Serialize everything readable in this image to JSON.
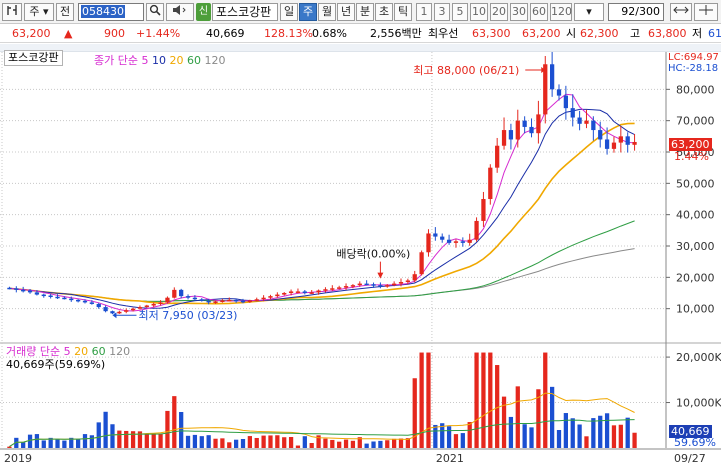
{
  "toolbar": {
    "market": "주",
    "prev_label": "전",
    "stock_code": "058430",
    "stock_name": "포스코강판",
    "badge": "신",
    "periods": [
      "일",
      "주",
      "월",
      "년",
      "분",
      "초",
      "틱"
    ],
    "active_period": "주",
    "minute_options": [
      "1",
      "3",
      "5",
      "10",
      "20",
      "30",
      "60",
      "120"
    ],
    "count": "92/300"
  },
  "quote": {
    "price": "63,200",
    "change": "900",
    "change_pct": "+1.44%",
    "volume": "40,669",
    "volume_ratio": "128.13%",
    "turnover": "0.68%",
    "amount": "2,556백만",
    "best_ask_label": "최우선",
    "best_ask": "63,300",
    "best_bid": "63,200",
    "open_label": "시",
    "open": "62,300",
    "high_label": "고",
    "high": "63,800",
    "low_label": "저",
    "low": "61"
  },
  "price_panel": {
    "title": "포스코강판",
    "legend_prefix": "종가 단순",
    "ma_periods": [
      "5",
      "10",
      "20",
      "60",
      "120"
    ],
    "lc": "LC:694.97",
    "hc": "HC:-28.18",
    "y_ticks": [
      "80,000",
      "70,000",
      "60,000",
      "50,000",
      "40,000",
      "30,000",
      "20,000",
      "10,000"
    ],
    "current_price": "63,200",
    "current_pct": "1.44%",
    "high_annotation": "최고 88,000 (06/21)",
    "low_annotation": "최저 7,950 (03/23)",
    "dividend_annotation": "배당락(0.00%)"
  },
  "volume_panel": {
    "legend_prefix": "거래량 단순",
    "ma_periods": [
      "5",
      "20",
      "60",
      "120"
    ],
    "current_value": "40,669주(59.69%)",
    "y_ticks": [
      "20,000K",
      "10,000K"
    ],
    "current_box": "40,669",
    "current_box_pct": "59.69%"
  },
  "x_axis": {
    "labels": [
      "2019",
      "2021"
    ],
    "right_label": "09/27"
  },
  "colors": {
    "up": "#e5271d",
    "down": "#1b4fd1",
    "ma5": "#d62bd0",
    "ma10": "#1a2ea8",
    "ma20": "#f0a800",
    "ma60": "#2f9e44",
    "ma120": "#8a8a8a"
  },
  "chart_data": {
    "type": "candlestick",
    "period": "weekly",
    "ylim": [
      0,
      90000
    ],
    "y_ticks": [
      10000,
      20000,
      30000,
      40000,
      50000,
      60000,
      70000,
      80000
    ],
    "close": [
      16500,
      16000,
      15800,
      15200,
      14500,
      14200,
      13800,
      13500,
      13200,
      12800,
      12500,
      12000,
      11500,
      10500,
      9200,
      8500,
      9000,
      9500,
      10000,
      10500,
      11000,
      11500,
      12000,
      13500,
      16000,
      14000,
      13500,
      13000,
      12500,
      12000,
      12300,
      12600,
      12800,
      12500,
      12200,
      12600,
      13000,
      13500,
      14000,
      14500,
      15000,
      15500,
      15500,
      15000,
      15200,
      15800,
      16200,
      16500,
      16800,
      17200,
      17500,
      18000,
      17800,
      17500,
      17200,
      17500,
      18000,
      18500,
      19000,
      21000,
      28000,
      34000,
      33000,
      32000,
      31000,
      31500,
      31000,
      32000,
      38000,
      45000,
      55000,
      62000,
      67000,
      64000,
      70000,
      68000,
      66000,
      72000,
      88000,
      80000,
      78000,
      74000,
      71000,
      69000,
      70000,
      67000,
      64000,
      61000,
      63000,
      65000,
      62300,
      63200
    ],
    "volume_panel": {
      "ylim": [
        0,
        22000
      ],
      "units": "K",
      "y_ticks": [
        10000,
        20000
      ]
    }
  }
}
